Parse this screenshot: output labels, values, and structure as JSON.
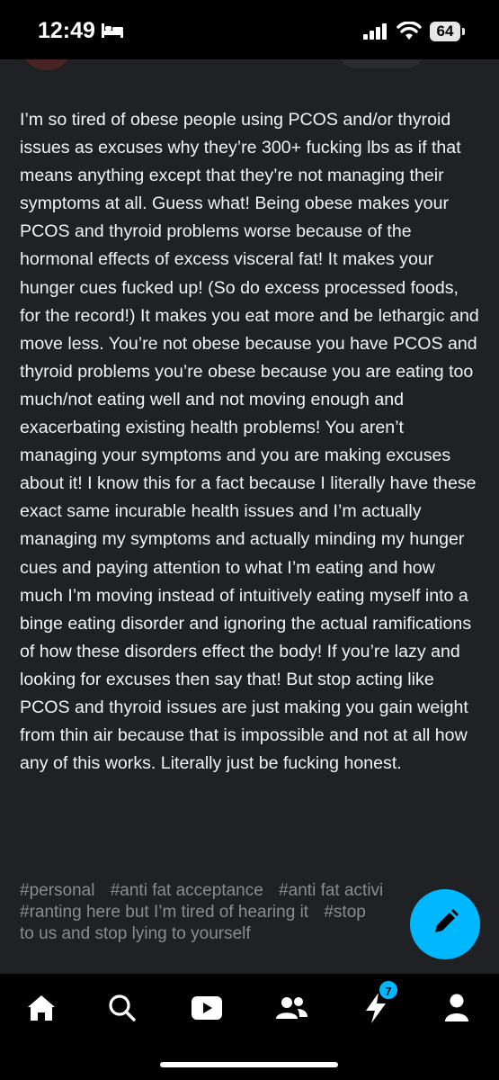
{
  "status_bar": {
    "time": "12:49",
    "battery": "64"
  },
  "post": {
    "body": "I’m so tired of obese people using PCOS and/or thyroid issues as excuses why they’re 300+ fucking lbs as if that means anything except that they’re not managing their symptoms at all. Guess what! Being obese makes your PCOS and thyroid problems worse because of the hormonal effects of excess visceral fat! It makes your hunger cues fucked up! (So do excess processed foods, for the record!) It makes you eat more and be lethargic and move less. You’re not obese because you have PCOS and thyroid problems you’re obese because you are eating too much/not eating well and not moving enough and exacerbating existing health problems! You aren’t managing your symptoms and you are making excuses about it! I know this for a fact because I literally have these exact same incurable health issues and I’m actually managing my symptoms and actually minding my hunger cues and paying attention to what I’m eating and how much I’m moving instead of intuitively eating myself into a binge eating disorder and ignoring the actual ramifications of how these disorders effect the body! If you’re lazy and looking for excuses then say that! But stop acting like PCOS and thyroid issues are just making you gain weight from thin air because that is impossible and not at all how any of this works. Literally just be fucking honest.",
    "tags": [
      "#personal",
      "#anti fat acceptance",
      "#anti fat activi",
      "#ranting here but I’m tired of hearing it",
      "#stop",
      "to us and stop lying to yourself"
    ]
  },
  "nav": {
    "items": [
      "home-icon",
      "search-icon",
      "video-icon",
      "community-icon",
      "activity-icon",
      "account-icon"
    ],
    "activity_badge": "7"
  },
  "colors": {
    "accent": "#00b8ff",
    "post_bg": "#1f2125",
    "tag_text": "#8a8c91"
  }
}
